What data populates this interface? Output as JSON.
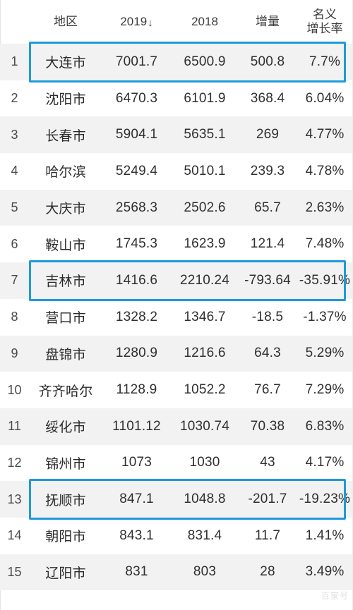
{
  "table": {
    "columns": [
      {
        "key": "rank",
        "label": "",
        "align": "center"
      },
      {
        "key": "name",
        "label": "地区",
        "align": "center"
      },
      {
        "key": "y2019",
        "label": "2019",
        "sort_indicator": "↓",
        "align": "center"
      },
      {
        "key": "y2018",
        "label": "2018",
        "align": "center"
      },
      {
        "key": "delta",
        "label": "增量",
        "align": "center"
      },
      {
        "key": "rate",
        "label_line1": "名义",
        "label_line2": "增长率",
        "align": "center"
      }
    ],
    "rows": [
      {
        "rank": "1",
        "name": "大连市",
        "y2019": "7001.7",
        "y2018": "6500.9",
        "delta": "500.8",
        "rate": "7.7%",
        "highlighted": true
      },
      {
        "rank": "2",
        "name": "沈阳市",
        "y2019": "6470.3",
        "y2018": "6101.9",
        "delta": "368.4",
        "rate": "6.04%",
        "highlighted": false
      },
      {
        "rank": "3",
        "name": "长春市",
        "y2019": "5904.1",
        "y2018": "5635.1",
        "delta": "269",
        "rate": "4.77%",
        "highlighted": false
      },
      {
        "rank": "4",
        "name": "哈尔滨",
        "y2019": "5249.4",
        "y2018": "5010.1",
        "delta": "239.3",
        "rate": "4.78%",
        "highlighted": false
      },
      {
        "rank": "5",
        "name": "大庆市",
        "y2019": "2568.3",
        "y2018": "2502.6",
        "delta": "65.7",
        "rate": "2.63%",
        "highlighted": false
      },
      {
        "rank": "6",
        "name": "鞍山市",
        "y2019": "1745.3",
        "y2018": "1623.9",
        "delta": "121.4",
        "rate": "7.48%",
        "highlighted": false
      },
      {
        "rank": "7",
        "name": "吉林市",
        "y2019": "1416.6",
        "y2018": "2210.24",
        "delta": "-793.64",
        "rate": "-35.91%",
        "highlighted": true
      },
      {
        "rank": "8",
        "name": "营口市",
        "y2019": "1328.2",
        "y2018": "1346.7",
        "delta": "-18.5",
        "rate": "-1.37%",
        "highlighted": false
      },
      {
        "rank": "9",
        "name": "盘锦市",
        "y2019": "1280.9",
        "y2018": "1216.6",
        "delta": "64.3",
        "rate": "5.29%",
        "highlighted": false
      },
      {
        "rank": "10",
        "name": "齐齐哈尔",
        "y2019": "1128.9",
        "y2018": "1052.2",
        "delta": "76.7",
        "rate": "7.29%",
        "highlighted": false
      },
      {
        "rank": "11",
        "name": "绥化市",
        "y2019": "1101.12",
        "y2018": "1030.74",
        "delta": "70.38",
        "rate": "6.83%",
        "highlighted": false
      },
      {
        "rank": "12",
        "name": "锦州市",
        "y2019": "1073",
        "y2018": "1030",
        "delta": "43",
        "rate": "4.17%",
        "highlighted": false
      },
      {
        "rank": "13",
        "name": "抚顺市",
        "y2019": "847.1",
        "y2018": "1048.8",
        "delta": "-201.7",
        "rate": "-19.23%",
        "highlighted": true
      },
      {
        "rank": "14",
        "name": "朝阳市",
        "y2019": "843.1",
        "y2018": "831.4",
        "delta": "11.7",
        "rate": "1.41%",
        "highlighted": false
      },
      {
        "rank": "15",
        "name": "辽阳市",
        "y2019": "831",
        "y2018": "803",
        "delta": "28",
        "rate": "3.49%",
        "highlighted": false
      }
    ]
  },
  "watermark": {
    "text": "百家号"
  },
  "colors": {
    "highlight_border": "#1e9ada",
    "stripe_background": "#f2f2f2",
    "row_background": "#ffffff",
    "text": "#2f2f2f"
  }
}
